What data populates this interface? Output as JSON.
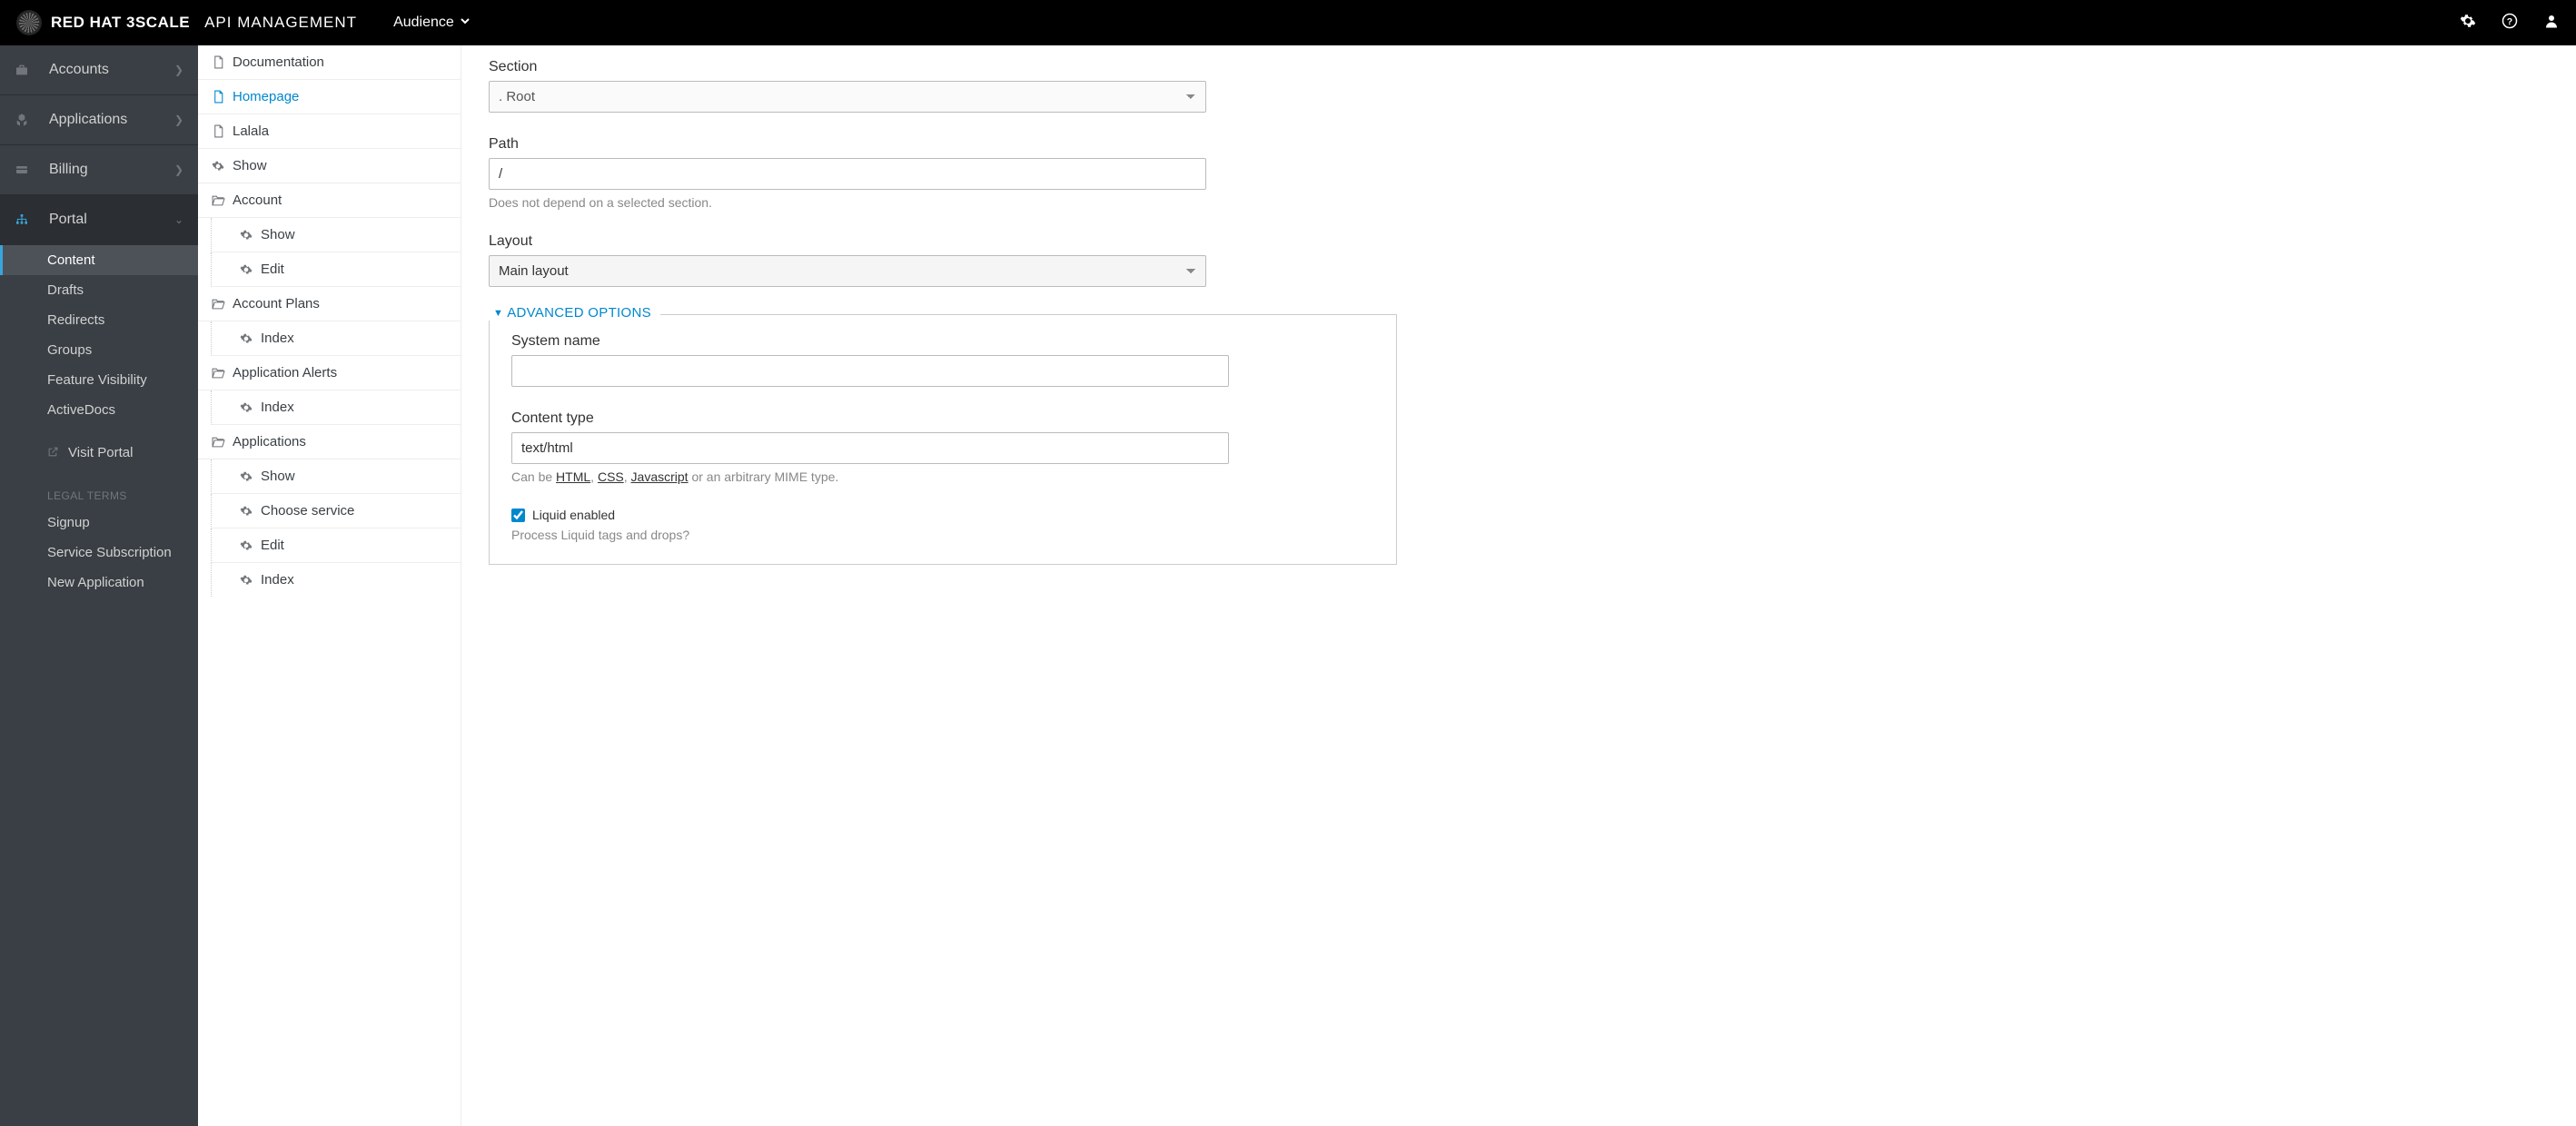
{
  "header": {
    "brand_strong": "RED HAT 3SCALE",
    "brand_light": "API MANAGEMENT",
    "menu_label": "Audience"
  },
  "sidebar": {
    "items": [
      {
        "label": "Accounts"
      },
      {
        "label": "Applications"
      },
      {
        "label": "Billing"
      },
      {
        "label": "Portal"
      }
    ],
    "portal_sub": [
      "Content",
      "Drafts",
      "Redirects",
      "Groups",
      "Feature Visibility",
      "ActiveDocs"
    ],
    "visit_portal": "Visit Portal",
    "legal_heading": "Legal Terms",
    "legal_sub": [
      "Signup",
      "Service Subscription",
      "New Application"
    ]
  },
  "tree": [
    {
      "label": "Documentation",
      "icon": "file",
      "depth": 0
    },
    {
      "label": "Homepage",
      "icon": "file",
      "depth": 0,
      "active": true
    },
    {
      "label": "Lalala",
      "icon": "file",
      "depth": 0
    },
    {
      "label": "Show",
      "icon": "gear",
      "depth": 0
    },
    {
      "label": "Account",
      "icon": "folder",
      "depth": 0
    },
    {
      "label": "Show",
      "icon": "gear",
      "depth": 1
    },
    {
      "label": "Edit",
      "icon": "gear",
      "depth": 1
    },
    {
      "label": "Account Plans",
      "icon": "folder",
      "depth": 0
    },
    {
      "label": "Index",
      "icon": "gear",
      "depth": 1
    },
    {
      "label": "Application Alerts",
      "icon": "folder",
      "depth": 0
    },
    {
      "label": "Index",
      "icon": "gear",
      "depth": 1
    },
    {
      "label": "Applications",
      "icon": "folder",
      "depth": 0
    },
    {
      "label": "Show",
      "icon": "gear",
      "depth": 1
    },
    {
      "label": "Choose service",
      "icon": "gear",
      "depth": 1
    },
    {
      "label": "Edit",
      "icon": "gear",
      "depth": 1
    },
    {
      "label": "Index",
      "icon": "gear",
      "depth": 1
    }
  ],
  "form": {
    "section_label": "Section",
    "section_value": ". Root",
    "path_label": "Path",
    "path_value": "/",
    "path_help": "Does not depend on a selected section.",
    "layout_label": "Layout",
    "layout_value": "Main layout",
    "advanced_title": "ADVANCED OPTIONS",
    "system_name_label": "System name",
    "system_name_value": "",
    "content_type_label": "Content type",
    "content_type_value": "text/html",
    "content_type_help_prefix": "Can be ",
    "content_type_help_links": [
      "HTML",
      "CSS",
      "Javascript"
    ],
    "content_type_help_suffix": " or an arbitrary MIME type.",
    "liquid_label": "Liquid enabled",
    "liquid_checked": true,
    "liquid_help": "Process Liquid tags and drops?"
  }
}
